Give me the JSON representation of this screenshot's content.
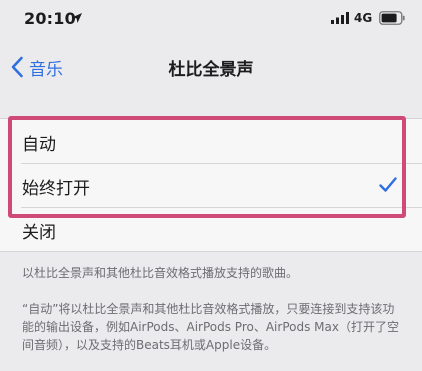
{
  "status_bar": {
    "time": "20:10",
    "network": "4G",
    "icons": [
      "location-icon",
      "signal-icon",
      "battery-icon"
    ]
  },
  "nav": {
    "back_label": "音乐",
    "title": "杜比全景声"
  },
  "options": [
    {
      "label": "自动",
      "selected": false
    },
    {
      "label": "始终打开",
      "selected": true
    },
    {
      "label": "关闭",
      "selected": false
    }
  ],
  "footer": {
    "note": "以杜比全景声和其他杜比音效格式播放支持的歌曲。",
    "description": "“自动”将以杜比全景声和其他杜比音效格式播放，只要连接到支持该功能的输出设备，例如AirPods、AirPods Pro、AirPods Max（打开了空间音频），以及支持的Beats耳机或Apple设备。"
  },
  "colors": {
    "accent": "#2f6fe0",
    "highlight": "#d04a78",
    "background": "#ebebed"
  }
}
